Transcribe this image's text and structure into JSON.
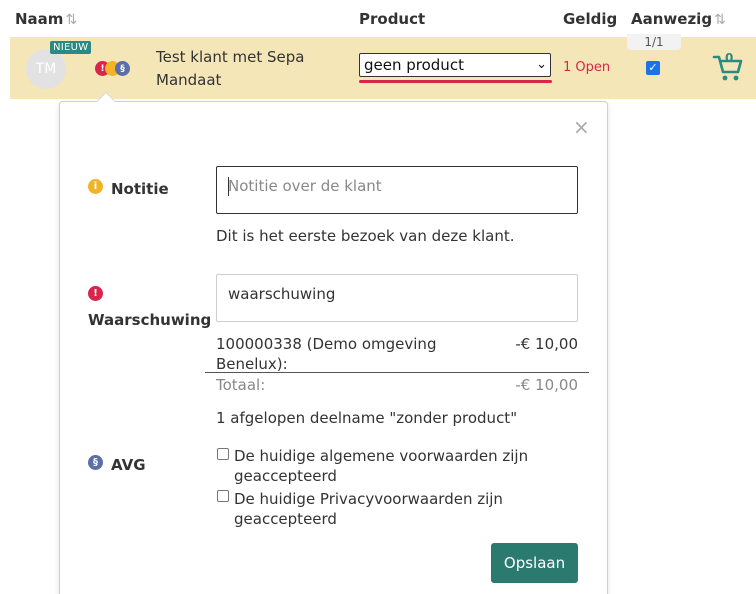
{
  "header": {
    "naam": "Naam",
    "product": "Product",
    "geldig": "Geldig",
    "aanwezig": "Aanwezig",
    "sort_icon": "sort-arrows-icon"
  },
  "row": {
    "initials": "TM",
    "badge": "NIEUW",
    "name": "Test klant met Sepa Mandaat",
    "product_selected": "geen product",
    "geldig": "1 Open",
    "counter": "1/1",
    "present_checked": true,
    "cart_count": "0",
    "dot_icons": [
      "alert-dot-icon",
      "info-dot-icon",
      "avg-dot-icon"
    ],
    "dot_labels": [
      "!",
      "§"
    ]
  },
  "popover": {
    "close": "×",
    "notitie": {
      "label": "Notitie",
      "icon": "info-icon",
      "icon_glyph": "i",
      "placeholder": "Notitie over de klant",
      "hint": "Dit is het eerste bezoek van deze klant."
    },
    "waarschuwing": {
      "label": "Waarschuwing",
      "icon": "alert-icon",
      "icon_glyph": "!",
      "value": "waarschuwing",
      "balance_label": "100000338 (Demo omgeving Benelux):",
      "balance_amount": "-€ 10,00",
      "total_label": "Totaal:",
      "total_amount": "-€ 10,00",
      "expired": "1 afgelopen deelname \"zonder product\""
    },
    "avg": {
      "label": "AVG",
      "icon": "avg-icon",
      "icon_glyph": "§",
      "terms": "De huidige algemene voorwaarden zijn geaccepteerd",
      "privacy": "De huidige Privacyvoorwaarden zijn geaccepteerd"
    },
    "save": "Opslaan"
  },
  "colors": {
    "row_bg": "#f5e6b8",
    "accent_teal": "#2a7a70",
    "alert_red": "#d6264b",
    "info_yellow": "#f0b429",
    "avg_blue": "#5b6ea8"
  }
}
